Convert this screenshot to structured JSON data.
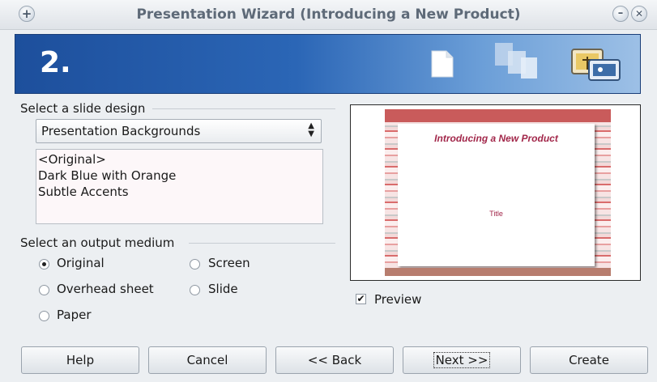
{
  "window": {
    "title": "Presentation Wizard (Introducing a New Product)",
    "menu_icon": "plus-icon",
    "minimize_icon": "minimize-icon",
    "close_icon": "close-icon"
  },
  "banner": {
    "step": "2.",
    "icons": [
      "blank-page-icon",
      "template-pages-icon",
      "image-icon"
    ]
  },
  "design": {
    "label": "Select a slide design",
    "category_value": "Presentation Backgrounds",
    "list": [
      "<Original>",
      "Dark Blue with Orange",
      "Subtle Accents"
    ]
  },
  "output": {
    "label": "Select an output medium",
    "options": [
      {
        "label": "Original",
        "checked": true
      },
      {
        "label": "Screen",
        "checked": false
      },
      {
        "label": "Overhead sheet",
        "checked": false
      },
      {
        "label": "Slide",
        "checked": false
      },
      {
        "label": "Paper",
        "checked": false
      }
    ]
  },
  "preview": {
    "slide_title": "Introducing a New Product",
    "slide_subtitle": "Title",
    "checkbox_label": "Preview",
    "checked": true
  },
  "buttons": {
    "help": "Help",
    "cancel": "Cancel",
    "back": "<< Back",
    "next": "Next >>",
    "create": "Create"
  },
  "colors": {
    "banner": "#2b66b6",
    "slide_title": "#a2274a",
    "slide_stripe": "#d96c6c"
  }
}
